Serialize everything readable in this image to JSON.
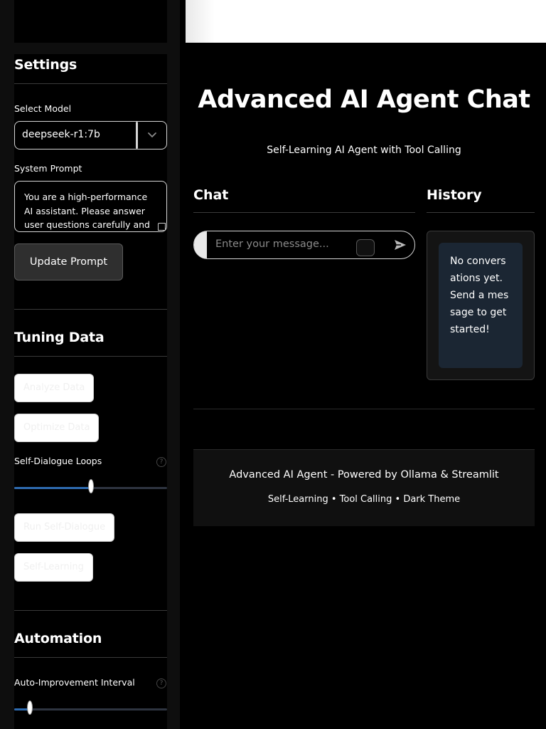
{
  "sidebar": {
    "settings": {
      "title": "Settings",
      "model_label": "Select Model",
      "model_value": "deepseek-r1:7b",
      "prompt_label": "System Prompt",
      "prompt_value": "You are a high-performance AI assistant. Please answer user questions carefully and",
      "update_button": "Update Prompt"
    },
    "tuning": {
      "title": "Tuning Data",
      "analyze_button": "Analyze Data",
      "optimize_button": "Optimize Data",
      "loops_label": "Self-Dialogue Loops",
      "loops_level": 0.5,
      "run_button": "Run Self-Dialogue",
      "learning_button": "Self-Learning"
    },
    "automation": {
      "title": "Automation",
      "interval_label": "Auto-Improvement Interval",
      "interval_level": 0.1
    },
    "help_glyph": "?"
  },
  "main": {
    "title": "Advanced AI Agent Chat",
    "subtitle": "Self-Learning AI Agent with Tool Calling",
    "chat": {
      "heading": "Chat",
      "input_placeholder": "Enter your message..."
    },
    "history": {
      "heading": "History",
      "empty_message": "No conversations yet. Send a message to get started!"
    }
  },
  "footer": {
    "line1": "Advanced AI Agent - Powered by Ollama & Streamlit",
    "line2": "Self-Learning • Tool Calling • Dark Theme"
  },
  "colors": {
    "slider_fill": "#2e6bb0",
    "history_card": "#1b2633",
    "background": "#000000"
  },
  "icons": {
    "select_chevron": "chevron-down-icon",
    "send": "send-icon",
    "help": "help-icon"
  }
}
